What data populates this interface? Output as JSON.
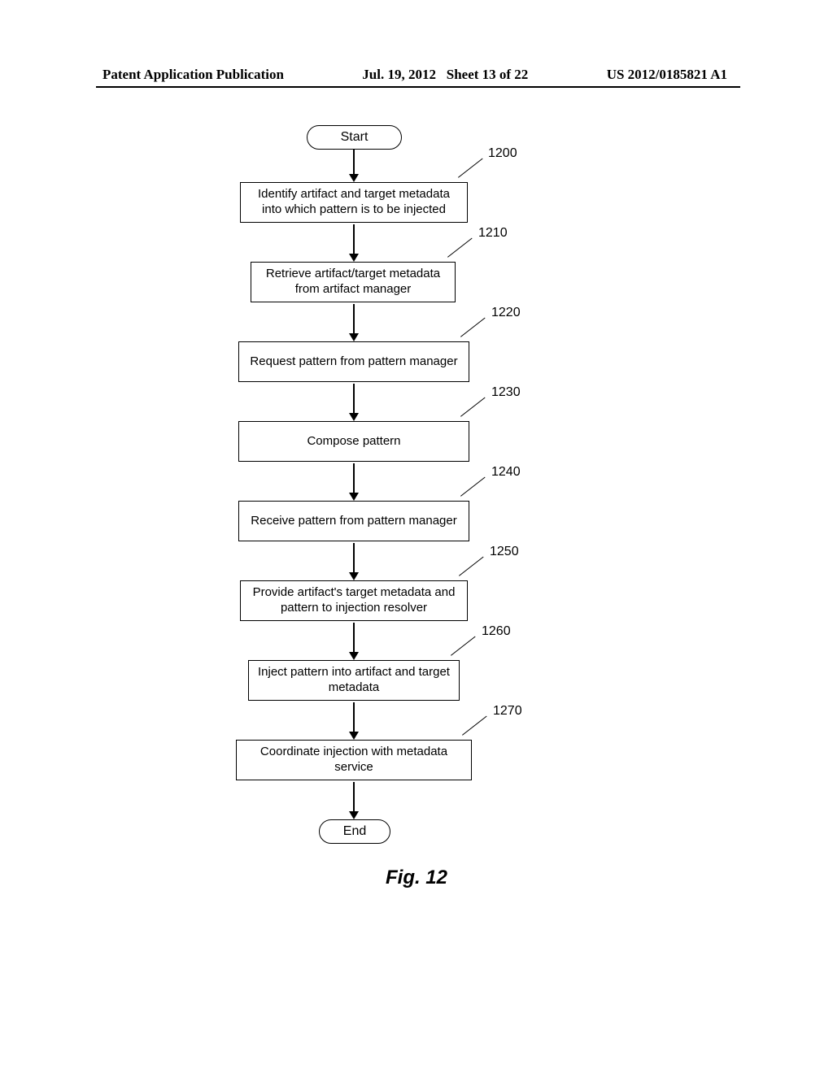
{
  "header": {
    "left": "Patent Application Publication",
    "center_date": "Jul. 19, 2012",
    "center_sheet": "Sheet 13 of 22",
    "right": "US 2012/0185821 A1"
  },
  "terminators": {
    "start": "Start",
    "end": "End"
  },
  "steps": [
    {
      "ref": "1200",
      "text": "Identify artifact and target metadata into which pattern is to be injected"
    },
    {
      "ref": "1210",
      "text": "Retrieve artifact/target metadata from artifact manager"
    },
    {
      "ref": "1220",
      "text": "Request pattern from pattern manager"
    },
    {
      "ref": "1230",
      "text": "Compose pattern"
    },
    {
      "ref": "1240",
      "text": "Receive pattern from pattern manager"
    },
    {
      "ref": "1250",
      "text": "Provide artifact's target metadata and pattern to injection resolver"
    },
    {
      "ref": "1260",
      "text": "Inject pattern into artifact and target metadata"
    },
    {
      "ref": "1270",
      "text": "Coordinate injection with metadata service"
    }
  ],
  "figure_caption": "Fig. 12"
}
